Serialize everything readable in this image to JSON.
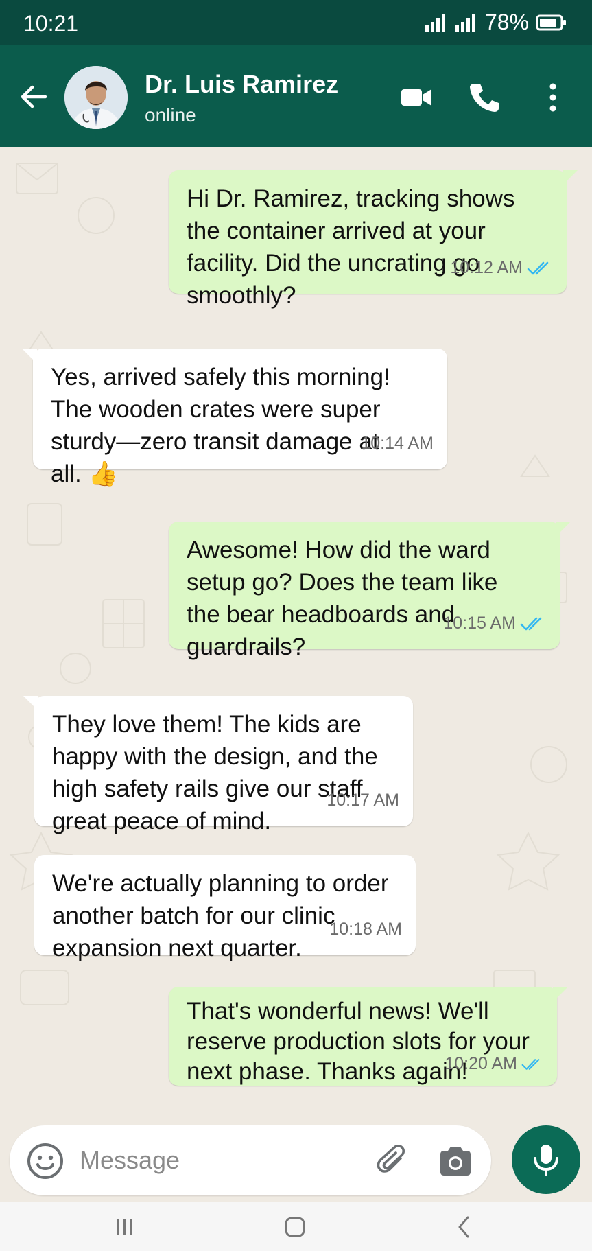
{
  "status": {
    "time": "10:21",
    "battery": "78%"
  },
  "header": {
    "name": "Dr. Luis Ramirez",
    "status": "online",
    "icons": [
      "back-arrow-icon",
      "video-call-icon",
      "phone-icon",
      "more-vert-icon"
    ]
  },
  "messages": [
    {
      "dir": "out",
      "text": "Hi Dr. Ramirez, tracking shows\nthe container arrived at your\nfacility. Did the uncrating go\nsmoothly?",
      "time": "10:12 AM",
      "read": true
    },
    {
      "dir": "in",
      "text": "Yes, arrived safely this morning!\nThe wooden crates were super\nsturdy—zero transit damage at\nall. 👍",
      "time": "10:14 AM"
    },
    {
      "dir": "out",
      "text": "Awesome! How did the ward\nsetup go? Does the team like\nthe bear headboards and\nguardrails?",
      "time": "10:15 AM",
      "read": true
    },
    {
      "dir": "in",
      "text": "They love them! The kids are\nhappy with the design, and the\nhigh safety rails give our staff\ngreat peace of mind.",
      "time": "10:17 AM"
    },
    {
      "dir": "in",
      "text": "We're actually planning to order\nanother batch for our clinic\nexpansion next quarter.",
      "time": "10:18 AM"
    },
    {
      "dir": "out",
      "text": "That's wonderful news! We'll\nreserve production slots for your\nnext phase. Thanks again!",
      "time": "10:20 AM",
      "read": true
    }
  ],
  "composer": {
    "placeholder": "Message"
  },
  "colors": {
    "header": "#0b5c4c",
    "statusbar": "#0a4a3f",
    "outgoing": "#dcf8c6",
    "incoming": "#ffffff",
    "read_ticks": "#34b7f1",
    "mic": "#0b6b56"
  }
}
